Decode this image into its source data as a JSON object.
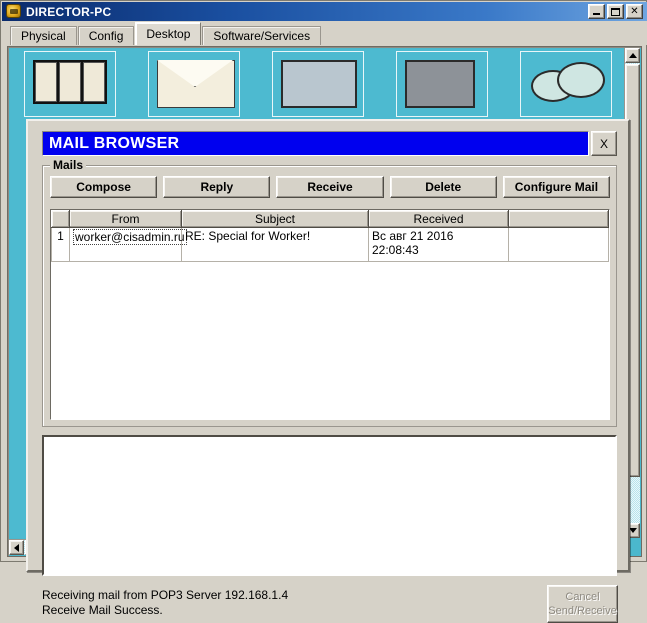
{
  "window": {
    "title": "DIRECTOR-PC",
    "icon": "packet-tracer-icon",
    "minimize_label": "_",
    "maximize_label": "□",
    "close_label": "✕"
  },
  "tabs": [
    {
      "label": "Physical",
      "active": false
    },
    {
      "label": "Config",
      "active": false
    },
    {
      "label": "Desktop",
      "active": true
    },
    {
      "label": "Software/Services",
      "active": false
    }
  ],
  "dialog": {
    "title": "MAIL BROWSER",
    "close_label": "X",
    "group_legend": "Mails",
    "toolbar": [
      {
        "label": "Compose"
      },
      {
        "label": "Reply"
      },
      {
        "label": "Receive"
      },
      {
        "label": "Delete"
      },
      {
        "label": "Configure Mail"
      }
    ],
    "table": {
      "columns": [
        "",
        "From",
        "Subject",
        "Received"
      ],
      "rows": [
        {
          "index": "1",
          "from": "worker@cisadmin.ru",
          "subject": "RE: Special for Worker!",
          "received_date": "Вс авг 21 2016",
          "received_time": "22:08:43"
        }
      ]
    },
    "message_body": "",
    "status": {
      "line1": "Receiving mail from POP3 Server  192.168.1.4",
      "line2": "Receive Mail Success."
    },
    "cancel_button": {
      "line1": "Cancel",
      "line2": "Send/Receive",
      "disabled": true
    }
  },
  "colors": {
    "desktop": "#4dbad0",
    "dialog_face": "#d6d2c8",
    "title_blue": "#0000ef",
    "titlebar_blue": "#1a4fa0"
  },
  "scrollbars": {
    "vertical_up": "scroll-up-arrow",
    "vertical_down": "scroll-down-arrow",
    "horizontal_left": "scroll-left-arrow",
    "horizontal_right": "scroll-right-arrow"
  }
}
